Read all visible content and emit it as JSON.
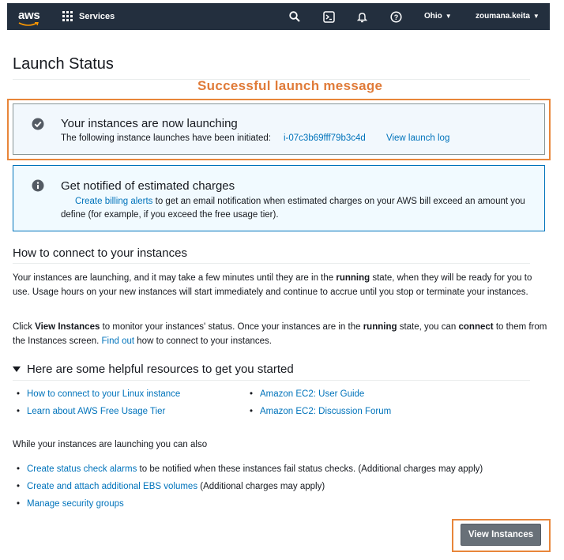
{
  "nav": {
    "logo_text": "aws",
    "services_label": "Services",
    "region": "Ohio",
    "account": "zoumana.keita",
    "icons": [
      "search-icon",
      "terminal-icon",
      "bell-icon",
      "help-icon"
    ]
  },
  "page": {
    "title": "Launch Status",
    "annotation": "Successful launch message"
  },
  "success": {
    "heading": "Your instances are now launching",
    "text": "The following instance launches have been initiated:",
    "instance_id": "i-07c3b69fff79b3c4d",
    "view_log": "View launch log"
  },
  "info": {
    "heading": "Get notified of estimated charges",
    "link": "Create billing alerts",
    "text": "to get an email notification when estimated charges on your AWS bill exceed an amount you define (for example, if you exceed the free usage tier)."
  },
  "connect": {
    "title": "How to connect to your instances",
    "p1_a": "Your instances are launching, and it may take a few minutes until they are in the",
    "p1_b": "running",
    "p1_c": "state, when they will be ready for you to use. Usage hours on your new instances will start immediately and continue to accrue until you stop or terminate your instances.",
    "p2_a": "Click",
    "p2_b": "View Instances",
    "p2_c": "to monitor your instances' status. Once your instances are in the",
    "p2_d": "running",
    "p2_e": "state, you can",
    "p2_f": "connect",
    "p2_g": "to them from the Instances screen.",
    "p2_link": "Find out",
    "p2_h": "how to connect to your instances."
  },
  "resources": {
    "title": "Here are some helpful resources to get you started",
    "left": [
      "How to connect to your Linux instance",
      "Learn about AWS Free Usage Tier"
    ],
    "right": [
      "Amazon EC2: User Guide",
      "Amazon EC2: Discussion Forum"
    ]
  },
  "while_launching": {
    "title": "While your instances are launching you can also",
    "items": [
      {
        "link": "Create status check alarms",
        "text": "to be notified when these instances fail status checks. (Additional charges may apply)"
      },
      {
        "link": "Create and attach additional EBS volumes",
        "text": "(Additional charges may apply)"
      },
      {
        "link": "Manage security groups",
        "text": ""
      }
    ]
  },
  "button": {
    "view_instances": "View Instances"
  },
  "colors": {
    "nav_bg": "#232f3e",
    "link": "#0073bb",
    "annotation": "#e07b39",
    "button": "#687078"
  }
}
